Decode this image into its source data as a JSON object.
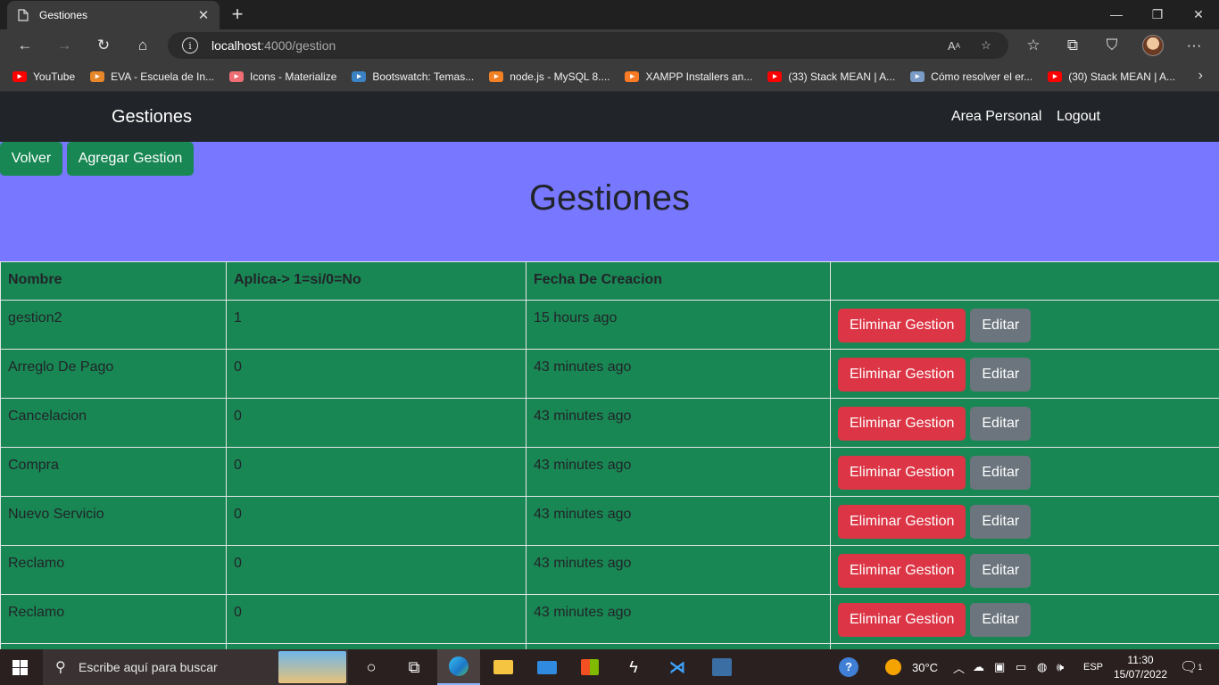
{
  "browser": {
    "tab_title": "Gestiones",
    "url_host": "localhost",
    "url_path": ":4000/gestion",
    "bookmarks": [
      {
        "label": "YouTube",
        "icon": "youtube-icon",
        "color": "#ff0000"
      },
      {
        "label": "EVA - Escuela de In...",
        "icon": "eva-icon",
        "color": "#e8872a"
      },
      {
        "label": "Icons - Materialize",
        "icon": "materialize-icon",
        "color": "#ee6e73"
      },
      {
        "label": "Bootswatch: Temas...",
        "icon": "bootswatch-icon",
        "color": "#3b82c4"
      },
      {
        "label": "node.js - MySQL 8....",
        "icon": "stackoverflow-icon",
        "color": "#f48024"
      },
      {
        "label": "XAMPP Installers an...",
        "icon": "xampp-icon",
        "color": "#fb7a24"
      },
      {
        "label": "(33) Stack MEAN | A...",
        "icon": "youtube-icon",
        "color": "#ff0000"
      },
      {
        "label": "Cómo resolver el er...",
        "icon": "stack-icon",
        "color": "#7a9cc6"
      },
      {
        "label": "(30) Stack MEAN | A...",
        "icon": "youtube-icon",
        "color": "#ff0000"
      }
    ]
  },
  "navbar": {
    "brand": "Gestiones",
    "links": [
      "Area Personal",
      "Logout"
    ]
  },
  "header": {
    "back_button": "Volver",
    "add_button": "Agregar Gestion",
    "title": "Gestiones"
  },
  "table": {
    "headers": [
      "Nombre",
      "Aplica-> 1=si/0=No",
      "Fecha De Creacion",
      ""
    ],
    "delete_label": "Eliminar Gestion",
    "edit_label": "Editar",
    "rows": [
      {
        "nombre": "gestion2",
        "aplica": "1",
        "fecha": "15 hours ago"
      },
      {
        "nombre": "Arreglo De Pago",
        "aplica": "0",
        "fecha": "43 minutes ago"
      },
      {
        "nombre": "Cancelacion",
        "aplica": "0",
        "fecha": "43 minutes ago"
      },
      {
        "nombre": "Compra",
        "aplica": "0",
        "fecha": "43 minutes ago"
      },
      {
        "nombre": "Nuevo Servicio",
        "aplica": "0",
        "fecha": "43 minutes ago"
      },
      {
        "nombre": "Reclamo",
        "aplica": "0",
        "fecha": "43 minutes ago"
      },
      {
        "nombre": "Reclamo",
        "aplica": "0",
        "fecha": "43 minutes ago"
      },
      {
        "nombre": "",
        "aplica": "",
        "fecha": ""
      }
    ]
  },
  "taskbar": {
    "search_placeholder": "Escribe aquí para buscar",
    "temperature": "30°C",
    "language": "ESP",
    "time": "11:30",
    "date": "15/07/2022",
    "notifications": "1"
  },
  "colors": {
    "header_band": "#7777ff",
    "table_bg": "#198754",
    "danger": "#dc3545",
    "secondary": "#6c757d",
    "navbar": "#212529"
  }
}
